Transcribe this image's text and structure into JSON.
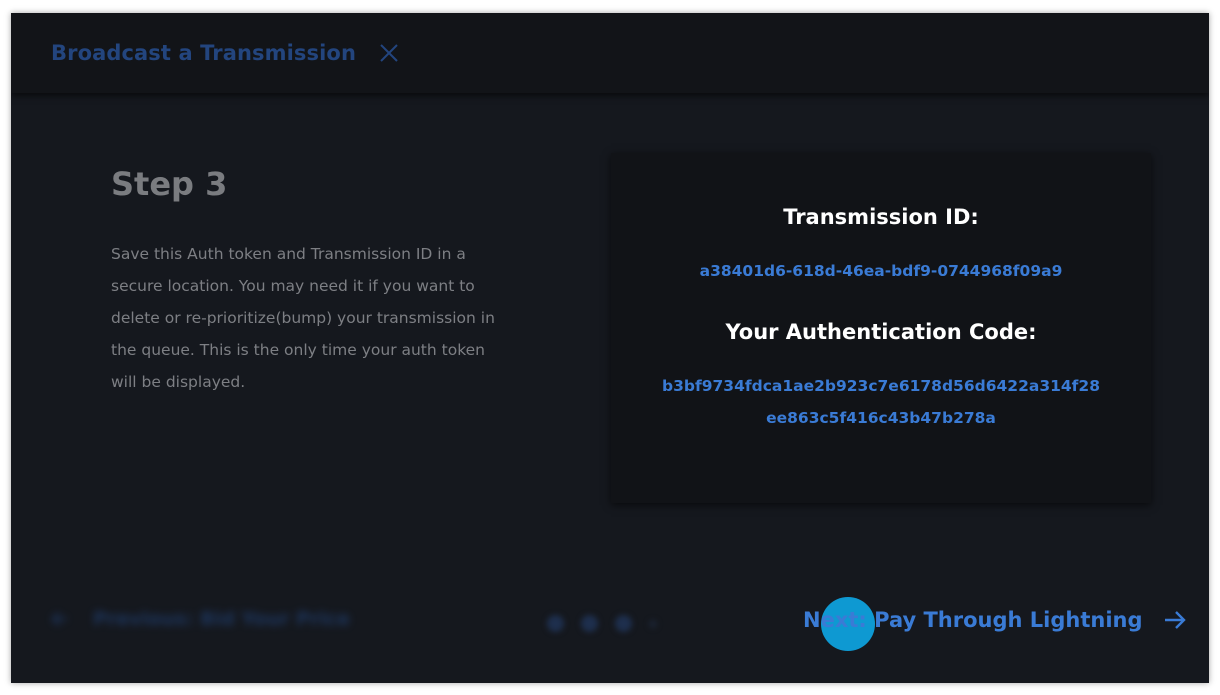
{
  "header": {
    "title": "Broadcast a Transmission",
    "close_icon": "close-icon"
  },
  "step": {
    "title": "Step 3",
    "description": "Save this Auth token and Transmission ID in a secure location. You may need it if you want to delete or re-prioritize(bump) your transmission in the queue. This is the only time your auth token will be displayed."
  },
  "card": {
    "transmission_label": "Transmission ID:",
    "transmission_id": "a38401d6-618d-46ea-bdf9-0744968f09a9",
    "auth_label": "Your Authentication Code:",
    "auth_code_line1": "b3bf9734fdca1ae2b923c7e6178d56d6422a314f28",
    "auth_code_line2": "ee863c5f416c43b47b278a"
  },
  "footer": {
    "prev_label": "Previous: Bid Your Price",
    "next_label": "Next: Pay Through Lightning",
    "prev_icon": "arrow-left-icon",
    "next_icon": "arrow-right-icon"
  },
  "colors": {
    "background": "#15181e",
    "header_bg": "#121418",
    "accent": "#3a7bd5",
    "header_title": "#23457e",
    "cursor": "#0ea0dc"
  }
}
